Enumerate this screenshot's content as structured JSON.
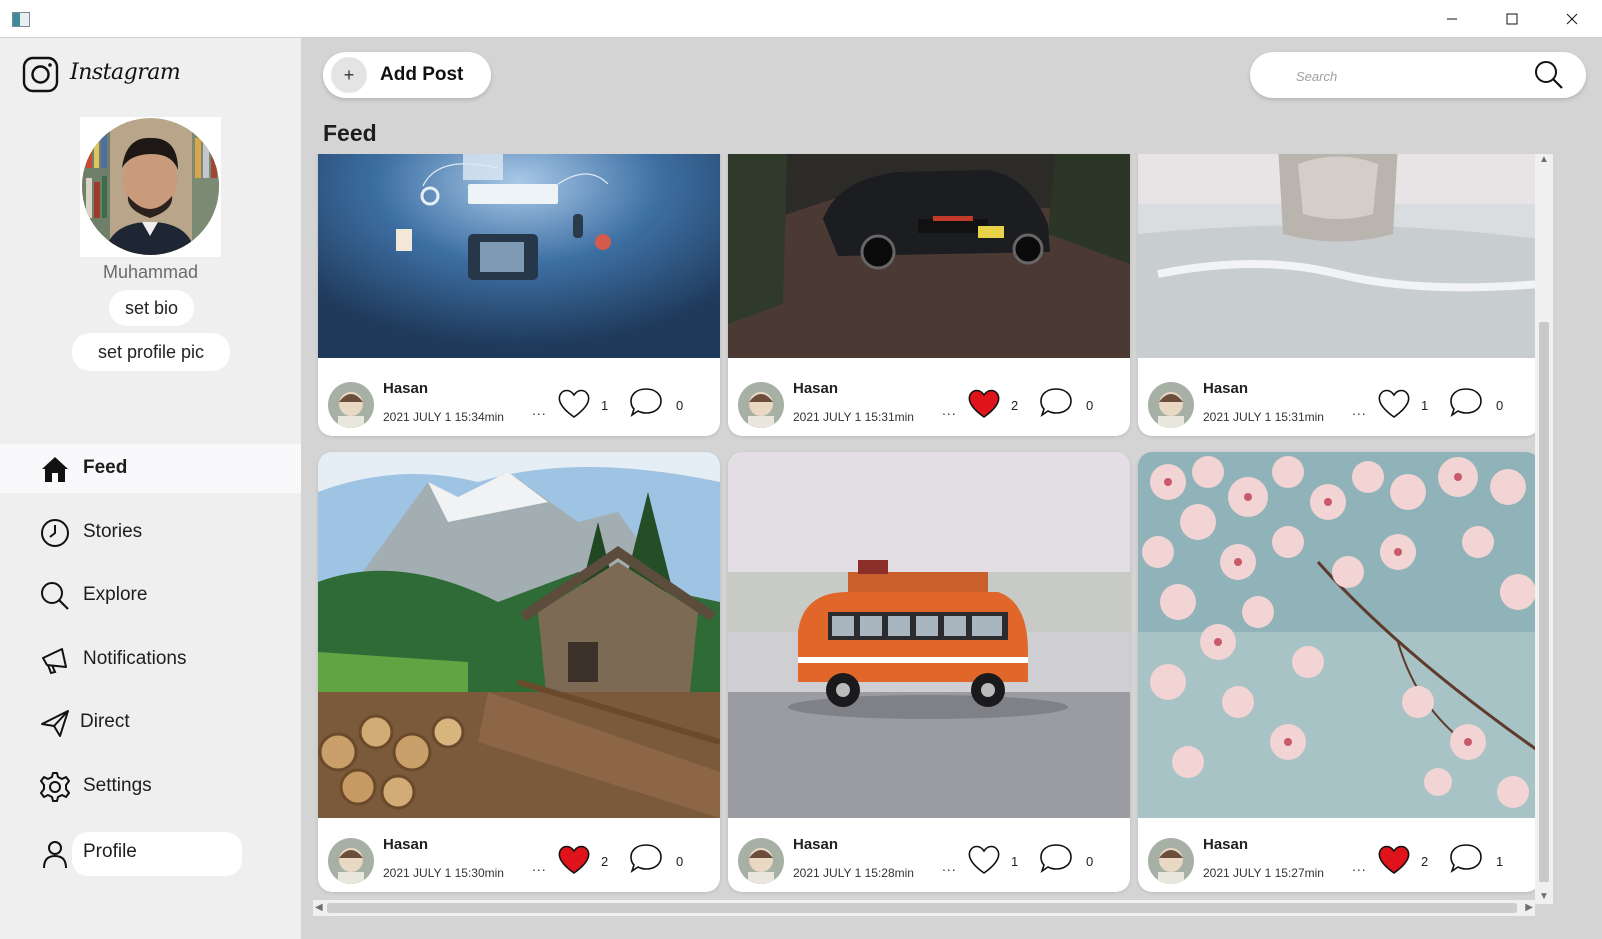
{
  "window": {
    "minimize": "─",
    "maximize": "☐",
    "close": "✕"
  },
  "app": {
    "logo_text": "Instagram"
  },
  "profile": {
    "username": "Muhammad",
    "set_bio": "set bio",
    "set_profile_pic": "set profile pic"
  },
  "nav": [
    {
      "label": "Feed",
      "icon": "home-icon",
      "active": true
    },
    {
      "label": "Stories",
      "icon": "clock-icon"
    },
    {
      "label": "Explore",
      "icon": "search-icon"
    },
    {
      "label": "Notifications",
      "icon": "megaphone-icon"
    },
    {
      "label": "Direct",
      "icon": "paper-plane-icon"
    },
    {
      "label": "Settings",
      "icon": "gear-icon"
    },
    {
      "label": "Profile",
      "icon": "user-icon"
    }
  ],
  "toolbar": {
    "add_post": "Add Post",
    "add_post_icon": "+",
    "search_placeholder": "Search"
  },
  "feed": {
    "title": "Feed",
    "posts": [
      {
        "author": "Hasan",
        "date": "2021 JULY 1 15:34min",
        "more": "...",
        "likes": "1",
        "comments": "0",
        "liked": false,
        "image": "desk-illustration"
      },
      {
        "author": "Hasan",
        "date": "2021 JULY 1 15:31min",
        "more": "...",
        "likes": "2",
        "comments": "0",
        "liked": true,
        "image": "black-sports-car"
      },
      {
        "author": "Hasan",
        "date": "2021 JULY 1 15:31min",
        "more": "...",
        "likes": "1",
        "comments": "0",
        "liked": false,
        "image": "cat-on-blanket"
      },
      {
        "author": "Hasan",
        "date": "2021 JULY 1 15:30min",
        "more": "...",
        "likes": "2",
        "comments": "0",
        "liked": true,
        "image": "mountain-cabin-logs"
      },
      {
        "author": "Hasan",
        "date": "2021 JULY 1 15:28min",
        "more": "...",
        "likes": "1",
        "comments": "0",
        "liked": false,
        "image": "orange-toy-bus"
      },
      {
        "author": "Hasan",
        "date": "2021 JULY 1 15:27min",
        "more": "...",
        "likes": "2",
        "comments": "1",
        "liked": true,
        "image": "cherry-blossom"
      }
    ]
  },
  "colors": {
    "liked": "#e0131b",
    "sidebar_bg": "#efefef",
    "main_bg": "#d4d4d4"
  }
}
